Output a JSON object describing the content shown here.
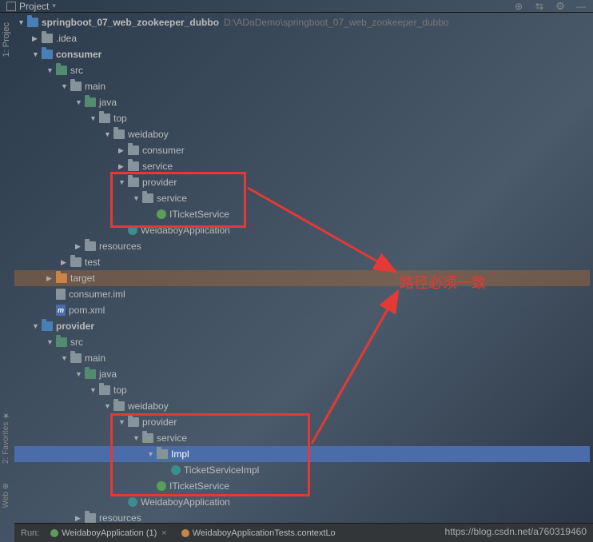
{
  "topbar": {
    "project_label": "Project",
    "icons": [
      "globe-icon",
      "collapse-icon",
      "gear-icon",
      "hide-icon"
    ]
  },
  "sidetabs": {
    "project": "1: Projec",
    "favorites": "2: Favorites",
    "web": "Web"
  },
  "tree": {
    "root": {
      "name": "springboot_07_web_zookeeper_dubbo",
      "path": "D:\\ADaDemo\\springboot_07_web_zookeeper_dubbo"
    },
    "items": [
      {
        "indent": 1,
        "arrow": "right",
        "icon": "folder",
        "label": ".idea"
      },
      {
        "indent": 1,
        "arrow": "down",
        "icon": "module",
        "label": "consumer",
        "bold": true
      },
      {
        "indent": 2,
        "arrow": "down",
        "icon": "source",
        "label": "src"
      },
      {
        "indent": 3,
        "arrow": "down",
        "icon": "folder",
        "label": "main"
      },
      {
        "indent": 4,
        "arrow": "down",
        "icon": "source",
        "label": "java"
      },
      {
        "indent": 5,
        "arrow": "down",
        "icon": "package",
        "label": "top"
      },
      {
        "indent": 6,
        "arrow": "down",
        "icon": "package",
        "label": "weidaboy"
      },
      {
        "indent": 7,
        "arrow": "right",
        "icon": "package",
        "label": "consumer"
      },
      {
        "indent": 7,
        "arrow": "right",
        "icon": "package",
        "label": "service"
      },
      {
        "indent": 7,
        "arrow": "down",
        "icon": "package",
        "label": "provider"
      },
      {
        "indent": 8,
        "arrow": "down",
        "icon": "package",
        "label": "service"
      },
      {
        "indent": 9,
        "arrow": "none",
        "icon": "interface",
        "label": "ITicketService"
      },
      {
        "indent": 7,
        "arrow": "none",
        "icon": "java",
        "label": "WeidaboyApplication"
      },
      {
        "indent": 4,
        "arrow": "right",
        "icon": "folder",
        "label": "resources"
      },
      {
        "indent": 3,
        "arrow": "right",
        "icon": "folder",
        "label": "test"
      },
      {
        "indent": 2,
        "arrow": "right",
        "icon": "target",
        "label": "target",
        "target": true
      },
      {
        "indent": 2,
        "arrow": "none",
        "icon": "file",
        "label": "consumer.iml"
      },
      {
        "indent": 2,
        "arrow": "none",
        "icon": "maven",
        "label": "pom.xml"
      },
      {
        "indent": 1,
        "arrow": "down",
        "icon": "module",
        "label": "provider",
        "bold": true
      },
      {
        "indent": 2,
        "arrow": "down",
        "icon": "source",
        "label": "src"
      },
      {
        "indent": 3,
        "arrow": "down",
        "icon": "folder",
        "label": "main"
      },
      {
        "indent": 4,
        "arrow": "down",
        "icon": "source",
        "label": "java"
      },
      {
        "indent": 5,
        "arrow": "down",
        "icon": "package",
        "label": "top"
      },
      {
        "indent": 6,
        "arrow": "down",
        "icon": "package",
        "label": "weidaboy"
      },
      {
        "indent": 7,
        "arrow": "down",
        "icon": "package",
        "label": "provider"
      },
      {
        "indent": 8,
        "arrow": "down",
        "icon": "package",
        "label": "service"
      },
      {
        "indent": 9,
        "arrow": "down",
        "icon": "package",
        "label": "Impl",
        "selected": true
      },
      {
        "indent": 10,
        "arrow": "none",
        "icon": "java",
        "label": "TicketServiceImpl"
      },
      {
        "indent": 9,
        "arrow": "none",
        "icon": "interface",
        "label": "ITicketService"
      },
      {
        "indent": 7,
        "arrow": "none",
        "icon": "java",
        "label": "WeidaboyApplication"
      },
      {
        "indent": 4,
        "arrow": "right",
        "icon": "folder",
        "label": "resources"
      }
    ]
  },
  "annotation": {
    "text": "路径必须一致"
  },
  "bottombar": {
    "run_label": "Run:",
    "tab1": "WeidaboyApplication (1)",
    "tab2": "WeidaboyApplicationTests.contextLo"
  },
  "watermark": "https://blog.csdn.net/a760319460"
}
